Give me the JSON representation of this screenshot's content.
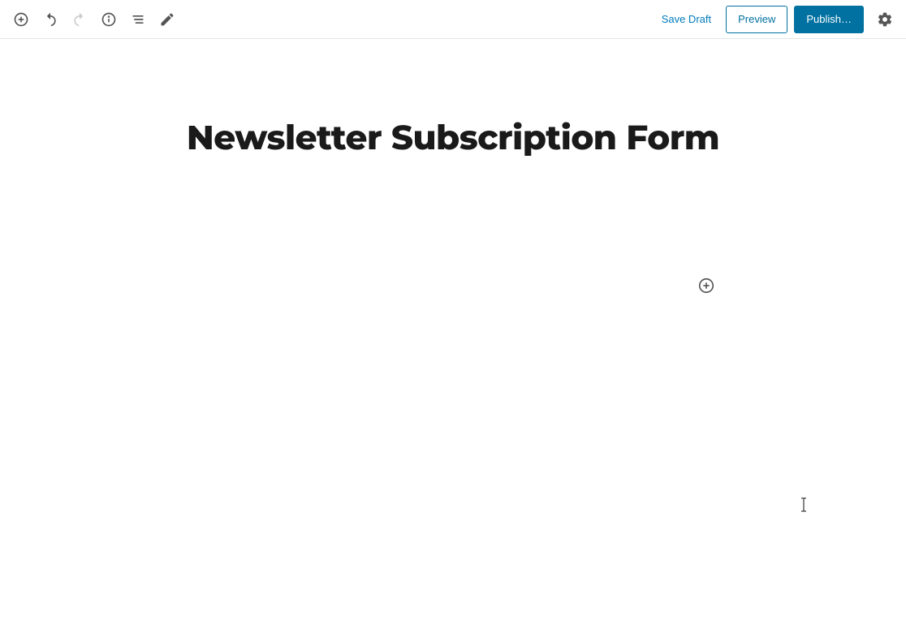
{
  "toolbar": {
    "save_draft_label": "Save Draft",
    "preview_label": "Preview",
    "publish_label": "Publish…"
  },
  "editor": {
    "title": "Newsletter Subscription Form"
  }
}
